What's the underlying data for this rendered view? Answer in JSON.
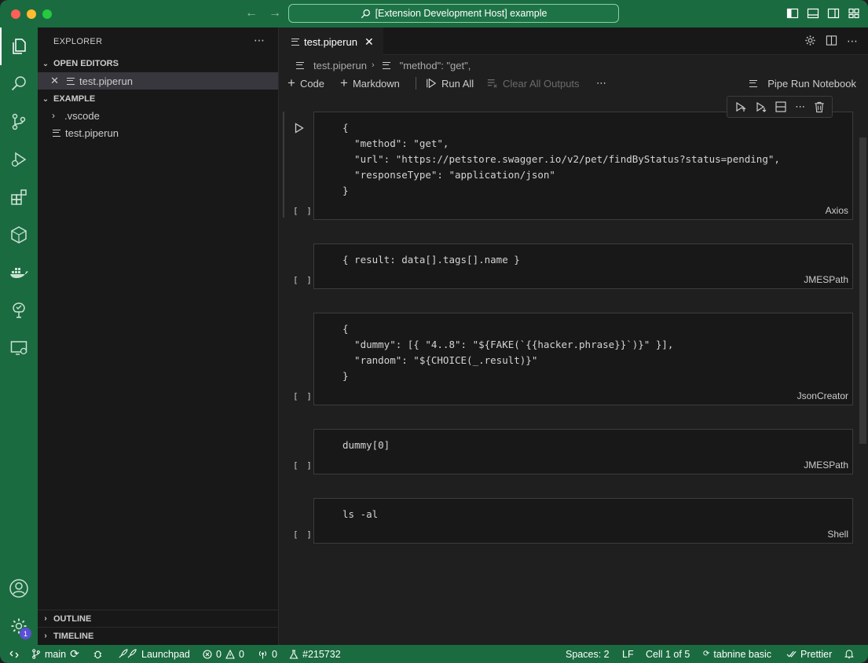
{
  "window": {
    "title": "[Extension Development Host] example"
  },
  "sidebar": {
    "title": "EXPLORER",
    "open_editors_label": "OPEN EDITORS",
    "open_editor_file": "test.piperun",
    "workspace_label": "EXAMPLE",
    "tree": [
      {
        "label": ".vscode",
        "type": "folder"
      },
      {
        "label": "test.piperun",
        "type": "file"
      }
    ],
    "outline_label": "OUTLINE",
    "timeline_label": "TIMELINE"
  },
  "activity": {
    "settings_badge": "1"
  },
  "editor": {
    "tab_label": "test.piperun",
    "breadcrumb_file": "test.piperun",
    "breadcrumb_symbol": "\"method\": \"get\","
  },
  "notebook_toolbar": {
    "code_label": "Code",
    "markdown_label": "Markdown",
    "run_all_label": "Run All",
    "clear_outputs_label": "Clear All Outputs",
    "kernel_label": "Pipe Run Notebook"
  },
  "cells": [
    {
      "exec": "[ ]",
      "language": "Axios",
      "lines": [
        "{",
        "  \"method\": \"get\",",
        "  \"url\": \"https://petstore.swagger.io/v2/pet/findByStatus?status=pending\",",
        "  \"responseType\": \"application/json\"",
        "}"
      ]
    },
    {
      "exec": "[ ]",
      "language": "JMESPath",
      "lines": [
        "{ result: data[].tags[].name }"
      ]
    },
    {
      "exec": "[ ]",
      "language": "JsonCreator",
      "lines": [
        "{",
        "  \"dummy\": [{ \"4..8\": \"${FAKE(`{{hacker.phrase}}`)}\" }],",
        "  \"random\": \"${CHOICE(_.result)}\"",
        "}"
      ]
    },
    {
      "exec": "[ ]",
      "language": "JMESPath",
      "lines": [
        "dummy[0]"
      ]
    },
    {
      "exec": "[ ]",
      "language": "Shell",
      "lines": [
        "ls -al"
      ]
    }
  ],
  "statusbar": {
    "branch": "main",
    "launchpad": "Launchpad",
    "errors": "0",
    "warnings": "0",
    "ports": "0",
    "issue": "#215732",
    "spaces": "Spaces: 2",
    "eol": "LF",
    "cell_position": "Cell 1 of 5",
    "tabnine": "tabnine basic",
    "prettier": "Prettier"
  },
  "colors": {
    "accent_green": "#1b6b40",
    "editor_bg": "#1f1f1f",
    "sidebar_bg": "#181818"
  }
}
